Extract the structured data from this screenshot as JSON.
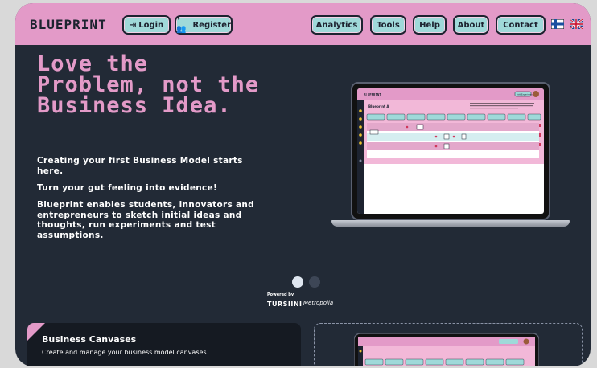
{
  "nav": {
    "brand": "BLUEPRINT",
    "login": "Login",
    "register": "Register",
    "analytics": "Analytics",
    "tools": "Tools",
    "help": "Help",
    "about": "About",
    "contact": "Contact"
  },
  "hero": {
    "title": "Love the Problem, not the Business Idea.",
    "p1": "Creating your first Business Model starts here.",
    "p2": "Turn your gut feeling into evidence!",
    "p3": "Blueprint enables students, innovators and entrepreneurs to sketch initial ideas and thoughts, run experiments and test assumptions."
  },
  "mockup": {
    "brand": "BLUEPRINT",
    "title": "Blueprint A",
    "button": "Add Experiment"
  },
  "carousel": {
    "active": 1,
    "total": 2
  },
  "partners": {
    "powered_by": "Powered by",
    "turku": "TURSIINI",
    "metropolia": "Metropolia"
  },
  "cards": {
    "canvases_title": "Business Canvases",
    "canvases_sub": "Create and manage your business model canvases"
  },
  "colors": {
    "pink": "#e39ac8",
    "teal": "#9fd9d9",
    "bg": "#222a36",
    "dark": "#1d2330"
  }
}
